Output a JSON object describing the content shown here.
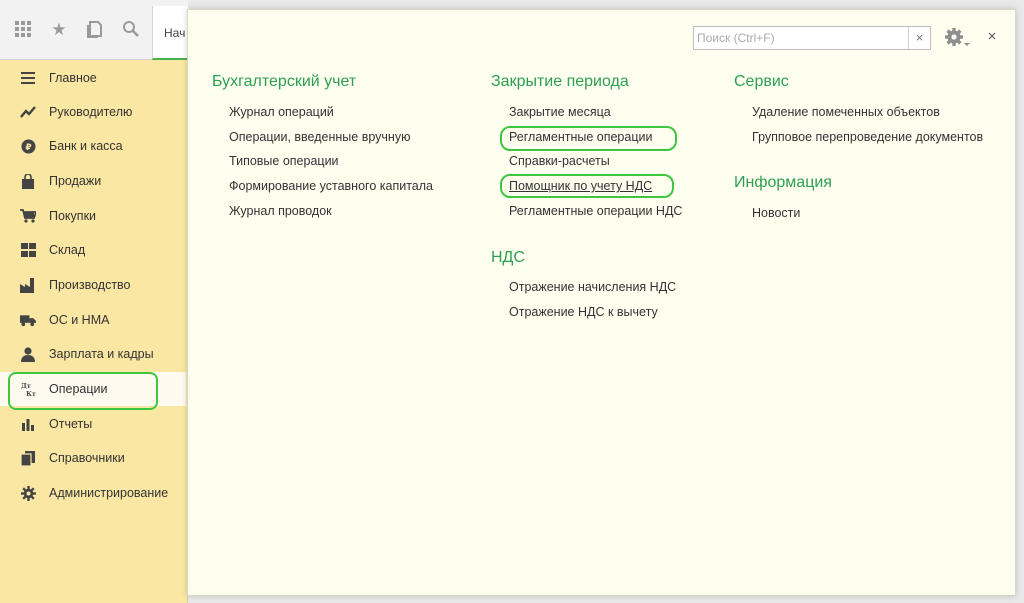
{
  "topbar": {
    "tab_stub_label": "Нач"
  },
  "sidebar": {
    "items": [
      {
        "label": "Главное",
        "icon": "menu-lines-icon"
      },
      {
        "label": "Руководителю",
        "icon": "trend-chart-icon"
      },
      {
        "label": "Банк и касса",
        "icon": "ruble-coin-icon"
      },
      {
        "label": "Продажи",
        "icon": "shopping-bag-icon"
      },
      {
        "label": "Покупки",
        "icon": "cart-icon"
      },
      {
        "label": "Склад",
        "icon": "warehouse-icon"
      },
      {
        "label": "Производство",
        "icon": "factory-icon"
      },
      {
        "label": "ОС и НМА",
        "icon": "truck-icon"
      },
      {
        "label": "Зарплата и кадры",
        "icon": "person-icon"
      },
      {
        "label": "Операции",
        "icon": "dt-kt-icon",
        "active": true
      },
      {
        "label": "Отчеты",
        "icon": "bar-chart-icon"
      },
      {
        "label": "Справочники",
        "icon": "books-icon"
      },
      {
        "label": "Администрирование",
        "icon": "gear-icon"
      }
    ]
  },
  "panel": {
    "search": {
      "placeholder": "Поиск (Ctrl+F)",
      "value": "",
      "clear_glyph": "×"
    },
    "close_glyph": "×",
    "sections": {
      "accounting": {
        "title": "Бухгалтерский учет",
        "links": [
          "Журнал операций",
          "Операции, введенные вручную",
          "Типовые операции",
          "Формирование уставного капитала",
          "Журнал проводок"
        ]
      },
      "period_close": {
        "title": "Закрытие периода",
        "links": [
          "Закрытие месяца",
          "Регламентные операции",
          "Справки-расчеты",
          "Помощник по учету НДС",
          "Регламентные операции НДС"
        ]
      },
      "vat": {
        "title": "НДС",
        "links": [
          "Отражение начисления НДС",
          "Отражение НДС к вычету"
        ]
      },
      "service": {
        "title": "Сервис",
        "links": [
          "Удаление помеченных объектов",
          "Групповое перепроведение документов"
        ]
      },
      "info": {
        "title": "Информация",
        "links": [
          "Новости"
        ]
      }
    }
  },
  "colors": {
    "section_title": "#2e9e52",
    "sidebar_bg": "#fbe7a4",
    "panel_bg": "#fffff0",
    "highlight": "#3ec63e"
  }
}
